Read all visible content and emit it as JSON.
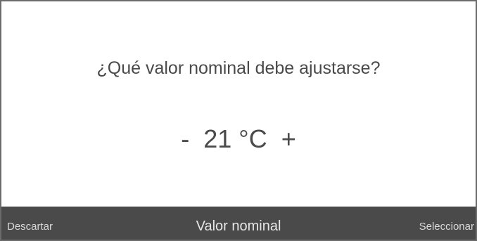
{
  "dialog": {
    "question": "¿Qué valor nominal debe ajustarse?",
    "value": "21 °C",
    "decrement_label": "-",
    "increment_label": "+"
  },
  "footer": {
    "left_label": "Descartar",
    "title": "Valor nominal",
    "right_label": "Seleccionar"
  }
}
